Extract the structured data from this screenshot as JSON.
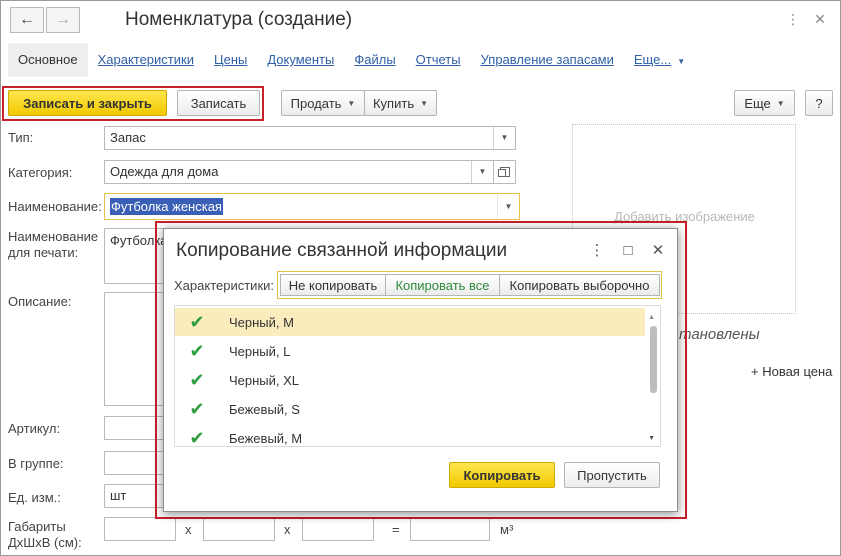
{
  "window": {
    "title": "Номенклатура (создание)",
    "nav_back": "←",
    "nav_forward": "→",
    "menu_icon": "⋮",
    "maximize_icon": "□",
    "close_icon": "✕"
  },
  "tabs": [
    {
      "label": "Основное"
    },
    {
      "label": "Характеристики"
    },
    {
      "label": "Цены"
    },
    {
      "label": "Документы"
    },
    {
      "label": "Файлы"
    },
    {
      "label": "Отчеты"
    },
    {
      "label": "Управление запасами"
    },
    {
      "label": "Еще..."
    }
  ],
  "toolbar": {
    "save_close": "Записать и закрыть",
    "save": "Записать",
    "sell": "Продать",
    "buy": "Купить",
    "more": "Еще",
    "help": "?"
  },
  "form": {
    "type_label": "Тип:",
    "type_value": "Запас",
    "category_label": "Категория:",
    "category_value": "Одежда для дома",
    "name_label": "Наименование:",
    "name_value": "Футболка женская",
    "print_name_label": "Наименование для печати:",
    "print_name_value": "Футболка",
    "description_label": "Описание:",
    "article_label": "Артикул:",
    "group_label": "В группе:",
    "unit_label": "Ед. изм.:",
    "unit_value": "шт",
    "dims_label": "Габариты ДхШхВ (см):",
    "dims_x1": "x",
    "dims_x2": "x",
    "dims_eq": "=",
    "dims_unit": "м³"
  },
  "image_area": {
    "add_image": "Добавить изображение"
  },
  "prices": {
    "not_set_partial": "тановлены",
    "new_price": "+ Новая цена"
  },
  "dialog": {
    "title": "Копирование связанной информации",
    "characteristics_label": "Характеристики:",
    "segments": [
      {
        "label": "Не копировать"
      },
      {
        "label": "Копировать все"
      },
      {
        "label": "Копировать выборочно"
      }
    ],
    "items": [
      {
        "label": "Черный, M"
      },
      {
        "label": "Черный, L"
      },
      {
        "label": "Черный, XL"
      },
      {
        "label": "Бежевый, S"
      },
      {
        "label": "Бежевый, M"
      }
    ],
    "check_mark": "✔",
    "copy_button": "Копировать",
    "skip_button": "Пропустить"
  },
  "colors": {
    "accent_yellow": "#f5d21a",
    "highlight_red": "#c8202a",
    "link_blue": "#2f5fa6",
    "check_green": "#2f9e3f",
    "selected_row": "#fbecbe"
  }
}
